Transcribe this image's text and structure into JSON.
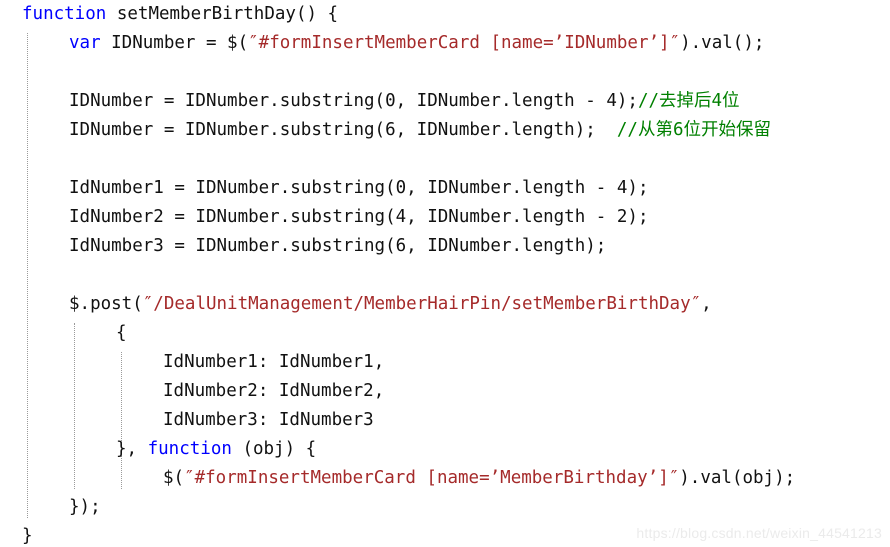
{
  "editor": {
    "background": "#ffffff",
    "language": "javascript",
    "font_size_px": 17.5,
    "line_height_px": 29,
    "colors": {
      "keyword": "#0000ff",
      "string": "#a52a2a",
      "comment": "#008000",
      "text": "#111111",
      "indent_guide": "#9a9a9a",
      "watermark": "#ebebeb"
    },
    "indent_guides_x": [
      27,
      74,
      121,
      168
    ],
    "lines": [
      {
        "number": 1,
        "indent": 0,
        "segments": [
          {
            "t": "function",
            "c": "kw"
          },
          {
            "t": " setMemberBirthDay() {",
            "c": "plain"
          }
        ]
      },
      {
        "number": 2,
        "indent": 1,
        "segments": [
          {
            "t": "var",
            "c": "kw"
          },
          {
            "t": " IDNumber = $(",
            "c": "plain"
          },
          {
            "t": "″#formInsertMemberCard [name=’IDNumber’]″",
            "c": "str"
          },
          {
            "t": ").val();",
            "c": "plain"
          }
        ]
      },
      {
        "number": 3,
        "indent": 1,
        "segments": []
      },
      {
        "number": 4,
        "indent": 1,
        "segments": [
          {
            "t": "IDNumber = IDNumber.substring(0, IDNumber.length - 4);",
            "c": "plain"
          },
          {
            "t": "//去掉后4位",
            "c": "com"
          }
        ]
      },
      {
        "number": 5,
        "indent": 1,
        "segments": [
          {
            "t": "IDNumber = IDNumber.substring(6, IDNumber.length);  ",
            "c": "plain"
          },
          {
            "t": "//从第6位开始保留",
            "c": "com"
          }
        ]
      },
      {
        "number": 6,
        "indent": 1,
        "segments": []
      },
      {
        "number": 7,
        "indent": 1,
        "segments": [
          {
            "t": "IdNumber1 = IDNumber.substring(0, IDNumber.length - 4);",
            "c": "plain"
          }
        ]
      },
      {
        "number": 8,
        "indent": 1,
        "segments": [
          {
            "t": "IdNumber2 = IDNumber.substring(4, IDNumber.length - 2);",
            "c": "plain"
          }
        ]
      },
      {
        "number": 9,
        "indent": 1,
        "segments": [
          {
            "t": "IdNumber3 = IDNumber.substring(6, IDNumber.length);",
            "c": "plain"
          }
        ]
      },
      {
        "number": 10,
        "indent": 1,
        "segments": []
      },
      {
        "number": 11,
        "indent": 1,
        "segments": [
          {
            "t": "$.post(",
            "c": "plain"
          },
          {
            "t": "″/DealUnitManagement/MemberHairPin/setMemberBirthDay″",
            "c": "str"
          },
          {
            "t": ",",
            "c": "plain"
          }
        ]
      },
      {
        "number": 12,
        "indent": 2,
        "segments": [
          {
            "t": "{",
            "c": "plain"
          }
        ]
      },
      {
        "number": 13,
        "indent": 3,
        "segments": [
          {
            "t": "IdNumber1: IdNumber1,",
            "c": "plain"
          }
        ]
      },
      {
        "number": 14,
        "indent": 3,
        "segments": [
          {
            "t": "IdNumber2: IdNumber2,",
            "c": "plain"
          }
        ]
      },
      {
        "number": 15,
        "indent": 3,
        "segments": [
          {
            "t": "IdNumber3: IdNumber3",
            "c": "plain"
          }
        ]
      },
      {
        "number": 16,
        "indent": 2,
        "segments": [
          {
            "t": "}, ",
            "c": "plain"
          },
          {
            "t": "function",
            "c": "kw"
          },
          {
            "t": " (obj) {",
            "c": "plain"
          }
        ]
      },
      {
        "number": 17,
        "indent": 3,
        "segments": [
          {
            "t": "$(",
            "c": "plain"
          },
          {
            "t": "″#formInsertMemberCard [name=’MemberBirthday’]″",
            "c": "str"
          },
          {
            "t": ").val(obj);",
            "c": "plain"
          }
        ]
      },
      {
        "number": 18,
        "indent": 1,
        "segments": [
          {
            "t": "});",
            "c": "plain"
          }
        ]
      },
      {
        "number": 19,
        "indent": 0,
        "segments": [
          {
            "t": "}",
            "c": "plain"
          }
        ]
      }
    ]
  },
  "watermark": {
    "text": "https://blog.csdn.net/weixin_44541213"
  }
}
